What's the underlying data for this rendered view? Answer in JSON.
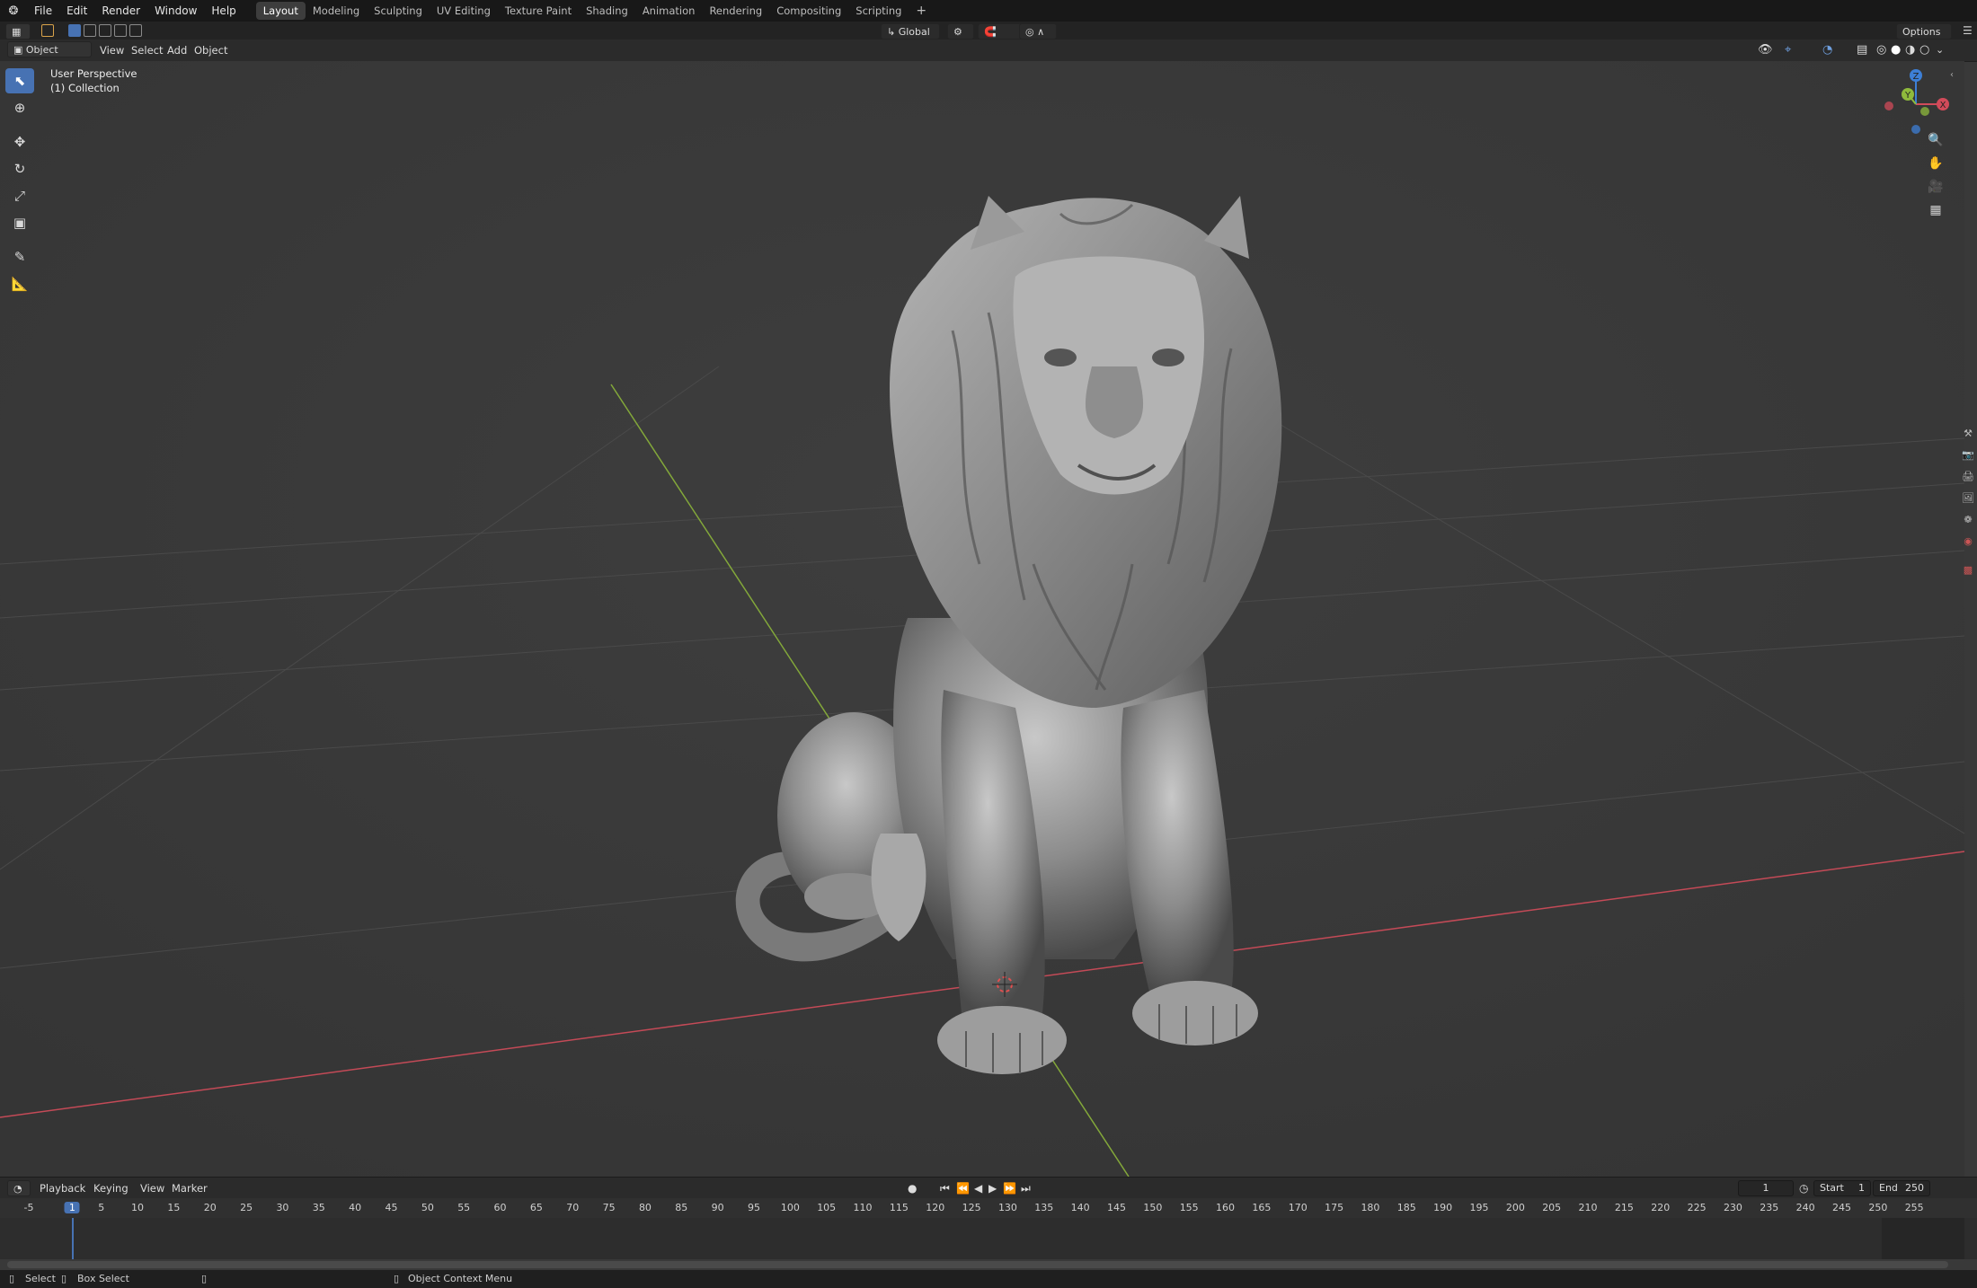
{
  "menubar": {
    "items": [
      "File",
      "Edit",
      "Render",
      "Window",
      "Help"
    ],
    "workspaces": [
      "Layout",
      "Modeling",
      "Sculpting",
      "UV Editing",
      "Texture Paint",
      "Shading",
      "Animation",
      "Rendering",
      "Compositing",
      "Scripting"
    ],
    "active_workspace": "Layout",
    "add_label": "+"
  },
  "toolheader": {
    "orientation": "Global",
    "options": "Options"
  },
  "viewheader": {
    "mode": "Object Mode",
    "menus": [
      "View",
      "Select",
      "Add",
      "Object"
    ]
  },
  "viewport": {
    "perspective": "User Perspective",
    "collection": "(1) Collection",
    "gizmo_axes": {
      "x": "X",
      "y": "Y",
      "z": "Z"
    }
  },
  "timeline": {
    "menus": [
      "Playback",
      "Keying",
      "View",
      "Marker"
    ],
    "current_frame": "1",
    "start_label": "Start",
    "start_value": "1",
    "end_label": "End",
    "end_value": "250",
    "ticks": [
      "-5",
      "1",
      "5",
      "10",
      "15",
      "20",
      "25",
      "30",
      "35",
      "40",
      "45",
      "50",
      "55",
      "60",
      "65",
      "70",
      "75",
      "80",
      "85",
      "90",
      "95",
      "100",
      "105",
      "110",
      "115",
      "120",
      "125",
      "130",
      "135",
      "140",
      "145",
      "150",
      "155",
      "160",
      "165",
      "170",
      "175",
      "180",
      "185",
      "190",
      "195",
      "200",
      "205",
      "210",
      "215",
      "220",
      "225",
      "230",
      "235",
      "240",
      "245",
      "250",
      "255"
    ]
  },
  "statusbar": {
    "select": "Select",
    "box_select": "Box Select",
    "context_menu": "Object Context Menu"
  },
  "colors": {
    "accent": "#4772b3",
    "x_axis": "#d24b5a",
    "y_axis": "#8fba3c",
    "z_axis": "#3d7fd6"
  }
}
